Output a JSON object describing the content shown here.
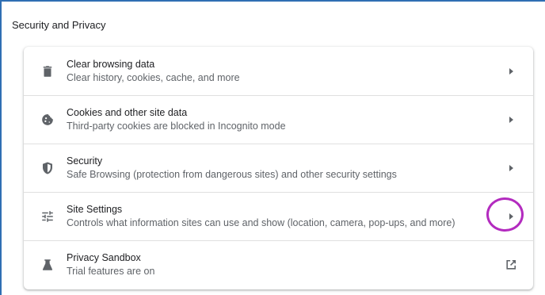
{
  "section": {
    "title": "Security and Privacy"
  },
  "items": [
    {
      "label": "Clear browsing data",
      "sub": "Clear history, cookies, cache, and more",
      "icon": "trash-icon",
      "action": "chevron-right-icon"
    },
    {
      "label": "Cookies and other site data",
      "sub": "Third-party cookies are blocked in Incognito mode",
      "icon": "cookie-icon",
      "action": "chevron-right-icon"
    },
    {
      "label": "Security",
      "sub": "Safe Browsing (protection from dangerous sites) and other security settings",
      "icon": "shield-icon",
      "action": "chevron-right-icon"
    },
    {
      "label": "Site Settings",
      "sub": "Controls what information sites can use and show (location, camera, pop-ups, and more)",
      "icon": "tune-icon",
      "action": "chevron-right-icon"
    },
    {
      "label": "Privacy Sandbox",
      "sub": "Trial features are on",
      "icon": "flask-icon",
      "action": "open-external-icon"
    }
  ],
  "colors": {
    "frame_border": "#2f6fb3",
    "highlight": "#b32bbf",
    "icon": "#5f6368"
  }
}
